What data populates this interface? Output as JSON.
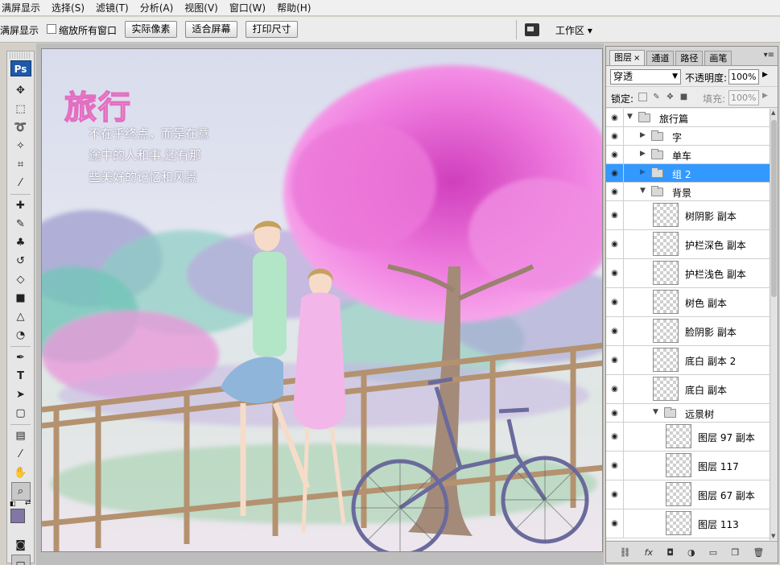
{
  "menu": [
    "满屏显示",
    "选择(S)",
    "滤镜(T)",
    "分析(A)",
    "视图(V)",
    "窗口(W)",
    "帮助(H)"
  ],
  "options": {
    "fullscreen_label": "满屏显示",
    "zoom_all_windows": "缩放所有窗口",
    "zoom_all_checked": false,
    "btn_actual": "实际像素",
    "btn_fit": "适合屏幕",
    "btn_print": "打印尺寸",
    "workspace": "工作区 ▾"
  },
  "tools": {
    "app_badge": "Ps",
    "fg_color": "#8276a6",
    "bg_color": "#f6e9f2"
  },
  "artwork": {
    "title": "旅行",
    "lines": [
      "不在乎终点，而是在意",
      "途中的人和事,还有那",
      "些美好的记忆和风景"
    ]
  },
  "layers_panel": {
    "tabs": [
      "图层",
      "通道",
      "路径",
      "画笔"
    ],
    "tab_close": "×",
    "menu_icon": "▾≡",
    "blend_mode": "穿透",
    "opacity_label": "不透明度:",
    "opacity_value": "100%",
    "lock_label": "锁定:",
    "fill_label": "填充:",
    "fill_value": "100%",
    "layers": [
      {
        "name": "旅行篇",
        "kind": "group",
        "open": true,
        "indent": 0
      },
      {
        "name": "字",
        "kind": "group",
        "open": false,
        "indent": 1
      },
      {
        "name": "单车",
        "kind": "group",
        "open": false,
        "indent": 1
      },
      {
        "name": "组 2",
        "kind": "group",
        "open": false,
        "indent": 1,
        "selected": true
      },
      {
        "name": "背景",
        "kind": "group",
        "open": true,
        "indent": 1
      },
      {
        "name": "树阴影 副本",
        "kind": "layer",
        "indent": 2
      },
      {
        "name": "护栏深色 副本",
        "kind": "layer",
        "indent": 2
      },
      {
        "name": "护栏浅色 副本",
        "kind": "layer",
        "indent": 2
      },
      {
        "name": "树色 副本",
        "kind": "layer",
        "indent": 2
      },
      {
        "name": "脸阴影 副本",
        "kind": "layer",
        "indent": 2
      },
      {
        "name": "底白 副本 2",
        "kind": "layer",
        "indent": 2
      },
      {
        "name": "底白 副本",
        "kind": "layer",
        "indent": 2
      },
      {
        "name": "远景树",
        "kind": "group",
        "open": true,
        "indent": 2
      },
      {
        "name": "图层 97 副本",
        "kind": "layer",
        "indent": 3
      },
      {
        "name": "图层 117",
        "kind": "layer",
        "indent": 3
      },
      {
        "name": "图层 67 副本",
        "kind": "layer",
        "indent": 3
      },
      {
        "name": "图层 113",
        "kind": "layer",
        "indent": 3
      }
    ],
    "bottom_icons": [
      "link-icon",
      "fx-icon",
      "mask-icon",
      "adjustment-icon",
      "folder-icon",
      "new-layer-icon",
      "trash-icon"
    ]
  }
}
